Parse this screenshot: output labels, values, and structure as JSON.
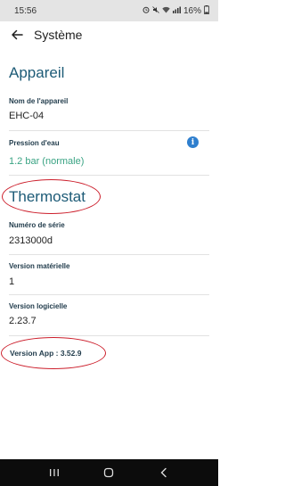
{
  "status_bar": {
    "time": "15:56",
    "battery": "16%",
    "icons": [
      "alarm-icon",
      "mute-icon",
      "wifi-icon",
      "signal-icon",
      "battery-icon"
    ]
  },
  "app_bar": {
    "title": "Système",
    "back_icon": "arrow-left-icon"
  },
  "appareil": {
    "section_title": "Appareil",
    "device_name_label": "Nom de l'appareil",
    "device_name_value": "EHC-04",
    "water_pressure_label": "Pression d'eau",
    "water_pressure_value": "1.2 bar (normale)",
    "info_icon": "info-icon"
  },
  "thermostat": {
    "section_title": "Thermostat",
    "serial_label": "Numéro de série",
    "serial_value": "2313000d",
    "hardware_label": "Version matérielle",
    "hardware_value": "1",
    "software_label": "Version logicielle",
    "software_value": "2.23.7"
  },
  "app_version": "Version App : 3.52.9",
  "colors": {
    "section_title": "#1d5b77",
    "ok_value": "#39a383",
    "info_icon": "#2f7fce",
    "annotation_circle": "#cc1e2b"
  },
  "nav_bar": {
    "buttons": [
      "recents-icon",
      "home-icon",
      "back-icon"
    ]
  }
}
